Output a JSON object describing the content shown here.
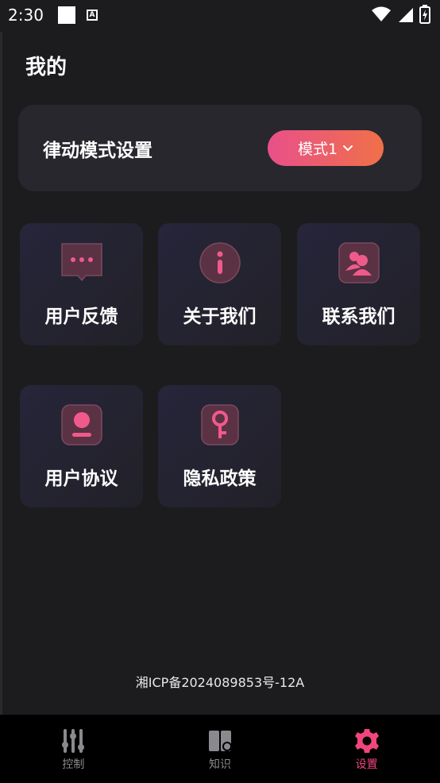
{
  "status_bar": {
    "time": "2:30"
  },
  "header": {
    "title": "我的"
  },
  "mode_card": {
    "label": "律动模式设置",
    "selected_mode": "模式1"
  },
  "tiles": [
    {
      "label": "用户反馈",
      "icon": "chat-bubble-icon"
    },
    {
      "label": "关于我们",
      "icon": "info-icon"
    },
    {
      "label": "联系我们",
      "icon": "contacts-icon"
    },
    {
      "label": "用户协议",
      "icon": "user-badge-icon"
    },
    {
      "label": "隐私政策",
      "icon": "key-lock-icon"
    }
  ],
  "footer": {
    "icp": "湘ICP备2024089853号-12A"
  },
  "bottom_nav": [
    {
      "label": "控制",
      "icon": "sliders-icon",
      "active": false
    },
    {
      "label": "知识",
      "icon": "book-icon",
      "active": false
    },
    {
      "label": "设置",
      "icon": "gear-icon",
      "active": true
    }
  ],
  "colors": {
    "accent": "#f2457c",
    "gradient_start": "#e8508a",
    "gradient_end": "#f07048",
    "background": "#1c1c1e"
  }
}
